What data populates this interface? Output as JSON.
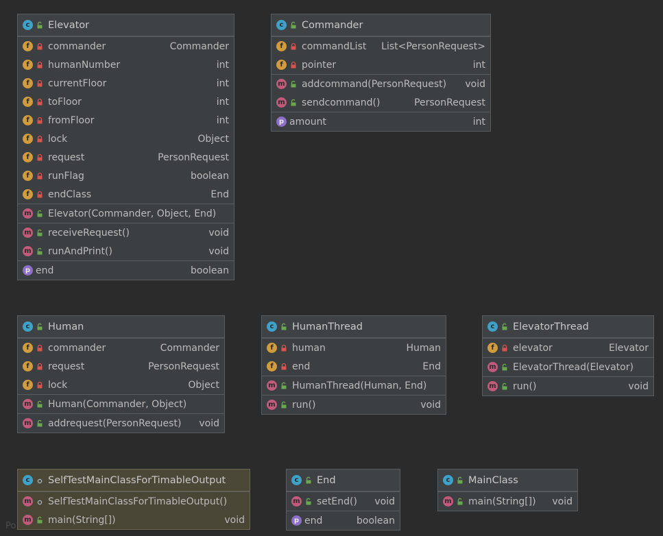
{
  "classes": [
    {
      "title": "Elevator",
      "kind": "c",
      "vis": "public",
      "sections": [
        [
          {
            "k": "f",
            "v": "private",
            "name": "commander",
            "type": "Commander"
          },
          {
            "k": "f",
            "v": "private",
            "name": "humanNumber",
            "type": "int"
          },
          {
            "k": "f",
            "v": "private",
            "name": "currentFloor",
            "type": "int"
          },
          {
            "k": "f",
            "v": "private",
            "name": "toFloor",
            "type": "int"
          },
          {
            "k": "f",
            "v": "private",
            "name": "fromFloor",
            "type": "int"
          },
          {
            "k": "f",
            "v": "private",
            "name": "lock",
            "type": "Object"
          },
          {
            "k": "f",
            "v": "private",
            "name": "request",
            "type": "PersonRequest"
          },
          {
            "k": "f",
            "v": "private",
            "name": "runFlag",
            "type": "boolean"
          },
          {
            "k": "f",
            "v": "private",
            "name": "endClass",
            "type": "End"
          }
        ],
        [
          {
            "k": "m",
            "v": "public",
            "name": "Elevator(Commander, Object, End)",
            "type": ""
          }
        ],
        [
          {
            "k": "m",
            "v": "public",
            "name": "receiveRequest()",
            "type": "void"
          },
          {
            "k": "m",
            "v": "public",
            "name": "runAndPrint()",
            "type": "void"
          }
        ],
        [
          {
            "k": "p",
            "v": "none",
            "name": "end",
            "type": "boolean"
          }
        ]
      ]
    },
    {
      "title": "Commander",
      "kind": "c",
      "vis": "public",
      "sections": [
        [
          {
            "k": "f",
            "v": "private",
            "name": "commandList",
            "type": "List<PersonRequest>"
          },
          {
            "k": "f",
            "v": "private",
            "name": "pointer",
            "type": "int"
          }
        ],
        [
          {
            "k": "m",
            "v": "public",
            "name": "addcommand(PersonRequest)",
            "type": "void"
          },
          {
            "k": "m",
            "v": "public",
            "name": "sendcommand()",
            "type": "PersonRequest"
          }
        ],
        [
          {
            "k": "p",
            "v": "none",
            "name": "amount",
            "type": "int"
          }
        ]
      ]
    },
    {
      "title": "Human",
      "kind": "c",
      "vis": "public",
      "sections": [
        [
          {
            "k": "f",
            "v": "private",
            "name": "commander",
            "type": "Commander"
          },
          {
            "k": "f",
            "v": "private",
            "name": "request",
            "type": "PersonRequest"
          },
          {
            "k": "f",
            "v": "private",
            "name": "lock",
            "type": "Object"
          }
        ],
        [
          {
            "k": "m",
            "v": "public",
            "name": "Human(Commander, Object)",
            "type": ""
          }
        ],
        [
          {
            "k": "m",
            "v": "public",
            "name": "addrequest(PersonRequest)",
            "type": "void"
          }
        ]
      ]
    },
    {
      "title": "HumanThread",
      "kind": "c",
      "vis": "public",
      "sections": [
        [
          {
            "k": "f",
            "v": "private",
            "name": "human",
            "type": "Human"
          },
          {
            "k": "f",
            "v": "private",
            "name": "end",
            "type": "End"
          }
        ],
        [
          {
            "k": "m",
            "v": "public",
            "name": "HumanThread(Human, End)",
            "type": ""
          }
        ],
        [
          {
            "k": "m",
            "v": "public",
            "name": "run()",
            "type": "void"
          }
        ]
      ]
    },
    {
      "title": "ElevatorThread",
      "kind": "c",
      "vis": "public",
      "sections": [
        [
          {
            "k": "f",
            "v": "private",
            "name": "elevator",
            "type": "Elevator"
          }
        ],
        [
          {
            "k": "m",
            "v": "public",
            "name": "ElevatorThread(Elevator)",
            "type": ""
          }
        ],
        [
          {
            "k": "m",
            "v": "public",
            "name": "run()",
            "type": "void"
          }
        ]
      ]
    },
    {
      "title": "SelfTestMainClassForTimableOutput",
      "kind": "c",
      "vis": "package",
      "main": true,
      "sections": [
        [
          {
            "k": "m",
            "v": "package",
            "name": "SelfTestMainClassForTimableOutput()",
            "type": ""
          },
          {
            "k": "m",
            "v": "public",
            "name": "main(String[])",
            "type": "void"
          }
        ]
      ]
    },
    {
      "title": "End",
      "kind": "c",
      "vis": "public",
      "sections": [
        [
          {
            "k": "m",
            "v": "public",
            "name": "setEnd()",
            "type": "void"
          }
        ],
        [
          {
            "k": "p",
            "v": "none",
            "name": "end",
            "type": "boolean"
          }
        ]
      ]
    },
    {
      "title": "MainClass",
      "kind": "c",
      "vis": "public",
      "sections": [
        [
          {
            "k": "m",
            "v": "public",
            "name": "main(String[])",
            "type": "void"
          }
        ]
      ]
    }
  ],
  "colors": {
    "background": "#2b2b2b",
    "panel": "#3c3f41",
    "main_panel": "#4a4636",
    "class_icon": "#3fa1c8",
    "field_icon": "#d29c3c",
    "method_icon": "#c25a7c",
    "property_icon": "#8e6fc7",
    "private_lock": "#d9534f",
    "public_lock": "#6aa84f"
  },
  "icons": {
    "class": "class-icon",
    "field": "field-icon",
    "method": "method-icon",
    "property": "property-icon"
  },
  "watermark": "Po"
}
